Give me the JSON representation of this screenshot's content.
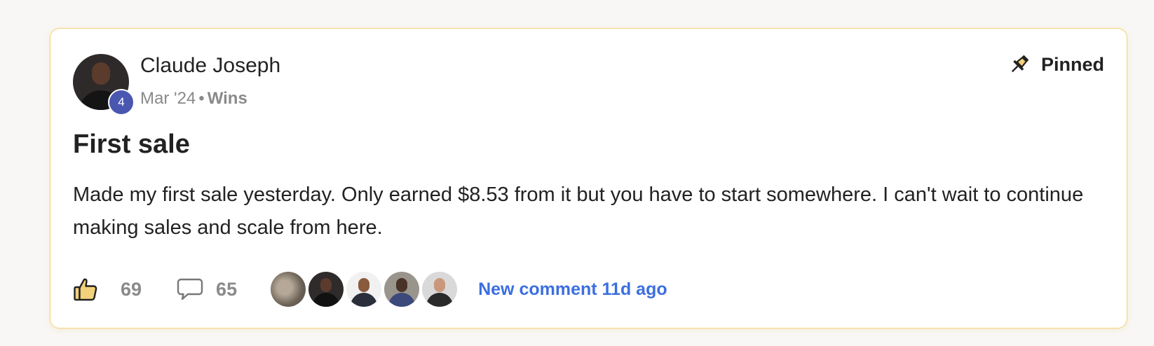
{
  "post": {
    "author": {
      "name": "Claude Joseph",
      "level": "4"
    },
    "date": "Mar '24",
    "separator": "•",
    "category": "Wins",
    "pinned_label": "Pinned",
    "title": "First sale",
    "body": "Made my first sale yesterday. Only earned $8.53 from it but you have to start somewhere. I can't wait to continue making sales and scale from here.",
    "likes": "69",
    "comments": "65",
    "new_comment": "New comment 11d ago"
  },
  "colors": {
    "card_border": "#f4d27a",
    "level_badge": "#4a57b0",
    "link": "#3b6fe0",
    "like_icon_fill": "#f2d27a",
    "muted_text": "#8a8a8a"
  },
  "icons": {
    "pin": "pushpin-icon",
    "like": "thumbs-up-icon",
    "comment": "speech-bubble-icon"
  }
}
